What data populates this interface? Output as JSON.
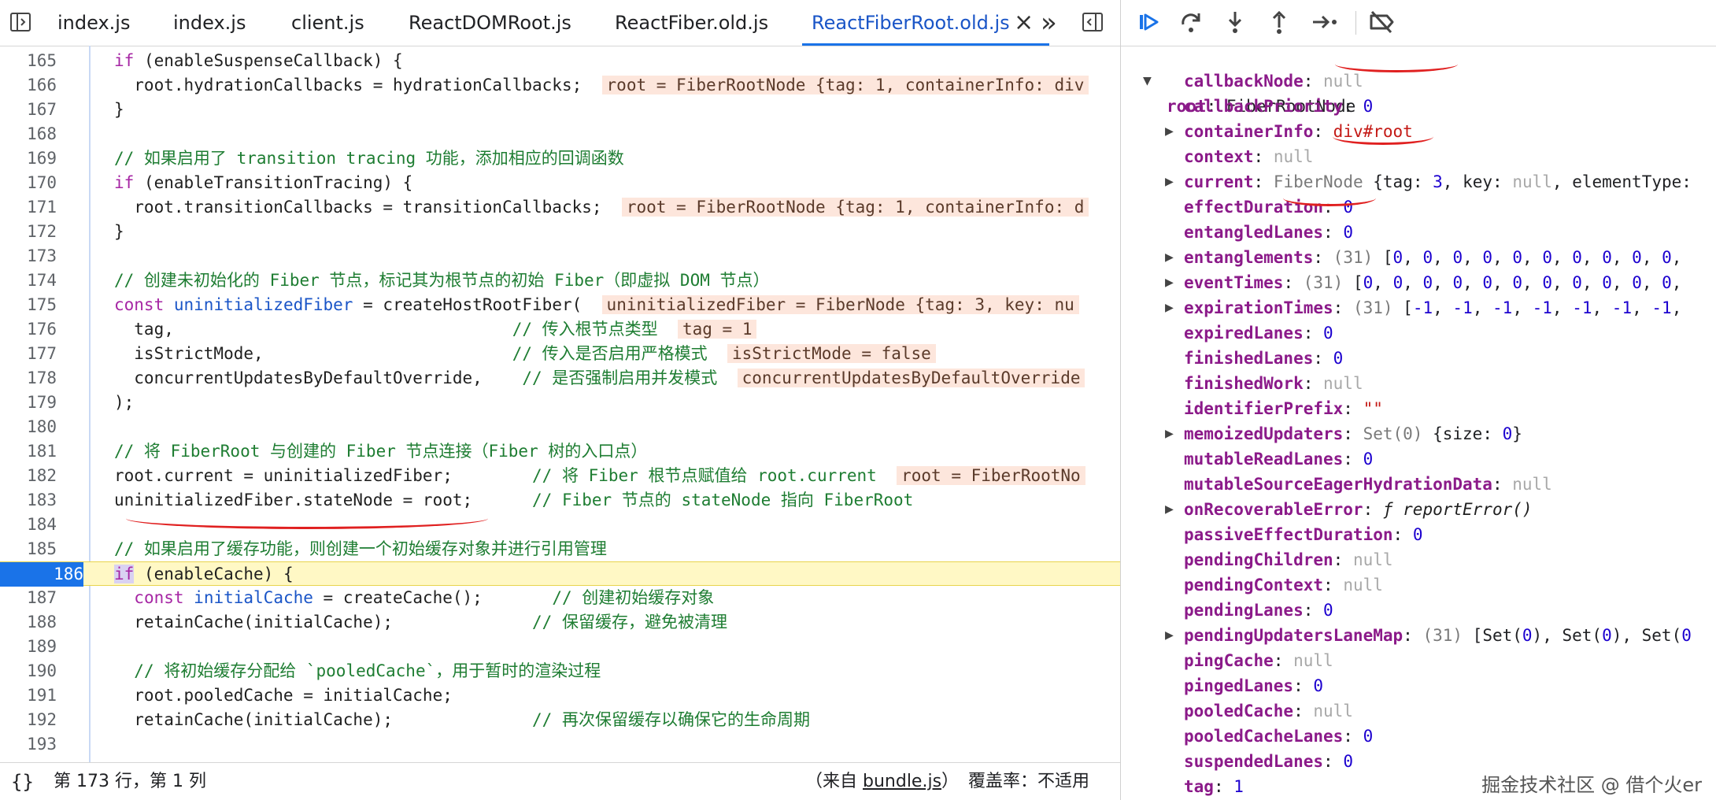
{
  "tabs": [
    {
      "label": "index.js"
    },
    {
      "label": "index.js"
    },
    {
      "label": "client.js"
    },
    {
      "label": "ReactDOMRoot.js"
    },
    {
      "label": "ReactFiber.old.js"
    },
    {
      "label": "ReactFiberRoot.old.js",
      "active": true
    }
  ],
  "tabbar": {
    "close_glyph": "×",
    "overflow_glyph": "»"
  },
  "code_lines": [
    {
      "n": "165",
      "t": "if (enableSuspenseCallback) {"
    },
    {
      "n": "166",
      "t": "  root.hydrationCallbacks = hydrationCallbacks;",
      "v": "root = FiberRootNode {tag: 1, containerInfo: div"
    },
    {
      "n": "167",
      "t": "}"
    },
    {
      "n": "168",
      "t": ""
    },
    {
      "n": "169",
      "t": "// 如果启用了 transition tracing 功能，添加相应的回调函数"
    },
    {
      "n": "170",
      "t": "if (enableTransitionTracing) {"
    },
    {
      "n": "171",
      "t": "  root.transitionCallbacks = transitionCallbacks;",
      "v": "root = FiberRootNode {tag: 1, containerInfo: d"
    },
    {
      "n": "172",
      "t": "}"
    },
    {
      "n": "173",
      "t": ""
    },
    {
      "n": "174",
      "t": "// 创建未初始化的 Fiber 节点，标记其为根节点的初始 Fiber（即虚拟 DOM 节点）"
    },
    {
      "n": "175",
      "t": "const uninitializedFiber = createHostRootFiber(",
      "v": "uninitializedFiber = FiberNode {tag: 3, key: nu"
    },
    {
      "n": "176",
      "t": "  tag,                                  // 传入根节点类型",
      "v": "tag = 1"
    },
    {
      "n": "177",
      "t": "  isStrictMode,                         // 传入是否启用严格模式",
      "v": "isStrictMode = false"
    },
    {
      "n": "178",
      "t": "  concurrentUpdatesByDefaultOverride,    // 是否强制启用并发模式",
      "v": "concurrentUpdatesByDefaultOverride"
    },
    {
      "n": "179",
      "t": ");"
    },
    {
      "n": "180",
      "t": ""
    },
    {
      "n": "181",
      "t": "// 将 FiberRoot 与创建的 Fiber 节点连接（Fiber 树的入口点）"
    },
    {
      "n": "182",
      "t": "root.current = uninitializedFiber;        // 将 Fiber 根节点赋值给 root.current",
      "v": "root = FiberRootNo"
    },
    {
      "n": "183",
      "t": "uninitializedFiber.stateNode = root;      // Fiber 节点的 stateNode 指向 FiberRoot"
    },
    {
      "n": "184",
      "t": ""
    },
    {
      "n": "185",
      "t": "// 如果启用了缓存功能，则创建一个初始缓存对象并进行引用管理"
    },
    {
      "n": "186",
      "t": "if (enableCache) {",
      "current": true
    },
    {
      "n": "187",
      "t": "  const initialCache = createCache();       // 创建初始缓存对象"
    },
    {
      "n": "188",
      "t": "  retainCache(initialCache);              // 保留缓存，避免被清理"
    },
    {
      "n": "189",
      "t": ""
    },
    {
      "n": "190",
      "t": "  // 将初始缓存分配给 `pooledCache`，用于暂时的渲染过程"
    },
    {
      "n": "191",
      "t": "  root.pooledCache = initialCache;"
    },
    {
      "n": "192",
      "t": "  retainCache(initialCache);              // 再次保留缓存以确保它的生命周期"
    },
    {
      "n": "193",
      "t": ""
    }
  ],
  "status": {
    "position": "第 173 行，第 1 列",
    "source_prefix": "（来自 ",
    "source_file": "bundle.js",
    "source_suffix": "）",
    "coverage": "覆盖率：不适用"
  },
  "scope": {
    "root_key": "root",
    "root_value": "FiberRootNode",
    "props": [
      {
        "k": "callbackNode",
        "v": "null",
        "vt": "null"
      },
      {
        "k": "callbackPriority",
        "v": "0",
        "vt": "num"
      },
      {
        "k": "containerInfo",
        "v": "div#root",
        "vt": "dom",
        "exp": true
      },
      {
        "k": "context",
        "v": "null",
        "vt": "null"
      },
      {
        "k": "current",
        "v": "FiberNode",
        "v2": " {tag: 3, key: null, elementType:",
        "vt": "obj",
        "exp": true
      },
      {
        "k": "effectDuration",
        "v": "0",
        "vt": "num"
      },
      {
        "k": "entangledLanes",
        "v": "0",
        "vt": "num"
      },
      {
        "k": "entanglements",
        "v": "(31)",
        "v2": " [0, 0, 0, 0, 0, 0, 0, 0, 0, 0,",
        "vt": "arr",
        "exp": true
      },
      {
        "k": "eventTimes",
        "v": "(31)",
        "v2": " [0, 0, 0, 0, 0, 0, 0, 0, 0, 0, 0,",
        "vt": "arr",
        "exp": true
      },
      {
        "k": "expirationTimes",
        "v": "(31)",
        "v2": " [-1, -1, -1, -1, -1, -1, -1,",
        "vt": "arr",
        "exp": true
      },
      {
        "k": "expiredLanes",
        "v": "0",
        "vt": "num"
      },
      {
        "k": "finishedLanes",
        "v": "0",
        "vt": "num"
      },
      {
        "k": "finishedWork",
        "v": "null",
        "vt": "null"
      },
      {
        "k": "identifierPrefix",
        "v": "\"\"",
        "vt": "str"
      },
      {
        "k": "memoizedUpdaters",
        "v": "Set(0)",
        "v2": " {size: 0}",
        "vt": "set",
        "exp": true
      },
      {
        "k": "mutableReadLanes",
        "v": "0",
        "vt": "num"
      },
      {
        "k": "mutableSourceEagerHydrationData",
        "v": "null",
        "vt": "null"
      },
      {
        "k": "onRecoverableError",
        "v": "ƒ reportError()",
        "vt": "fn",
        "exp": true
      },
      {
        "k": "passiveEffectDuration",
        "v": "0",
        "vt": "num"
      },
      {
        "k": "pendingChildren",
        "v": "null",
        "vt": "null"
      },
      {
        "k": "pendingContext",
        "v": "null",
        "vt": "null"
      },
      {
        "k": "pendingLanes",
        "v": "0",
        "vt": "num"
      },
      {
        "k": "pendingUpdatersLaneMap",
        "v": "(31)",
        "v2": " [Set(0), Set(0), Set(0",
        "vt": "arr",
        "exp": true
      },
      {
        "k": "pingCache",
        "v": "null",
        "vt": "null"
      },
      {
        "k": "pingedLanes",
        "v": "0",
        "vt": "num"
      },
      {
        "k": "pooledCache",
        "v": "null",
        "vt": "null"
      },
      {
        "k": "pooledCacheLanes",
        "v": "0",
        "vt": "num"
      },
      {
        "k": "suspendedLanes",
        "v": "0",
        "vt": "num"
      },
      {
        "k": "tag",
        "v": "1",
        "vt": "num"
      }
    ]
  },
  "watermark": "掘金技术社区 @ 借个火er",
  "colors": {
    "accent": "#1a73e8",
    "exec_highlight": "#fff8c5",
    "annotation_red": "#e02020"
  }
}
